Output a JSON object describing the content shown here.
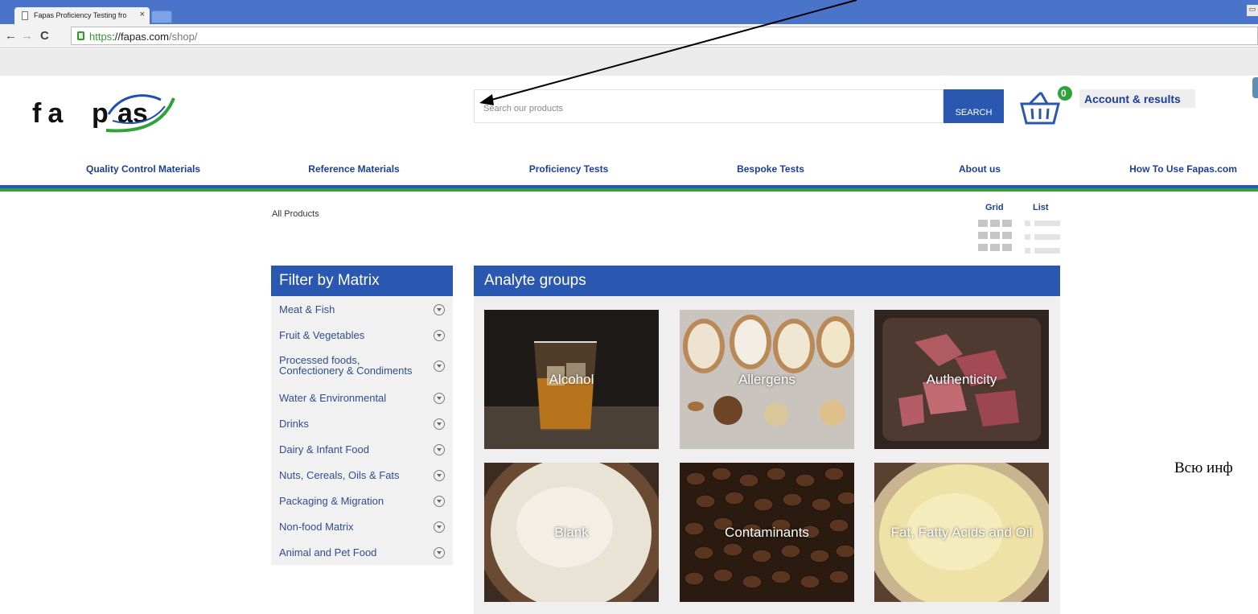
{
  "browser": {
    "tab_title": "Fapas Proficiency Testing fro",
    "tab_close": "×",
    "url_scheme": "https",
    "url_host": "://fapas.com",
    "url_path": "/shop/",
    "back_label": "←",
    "forward_label": "→",
    "reload_label": "C"
  },
  "header": {
    "logo_text": "fapas",
    "search_placeholder": "Search our products",
    "search_button": "SEARCH",
    "cart_count": "0",
    "account_label": "Account & results"
  },
  "nav": {
    "items": [
      {
        "label": "Quality Control Materials"
      },
      {
        "label": "Reference Materials"
      },
      {
        "label": "Proficiency Tests"
      },
      {
        "label": "Bespoke Tests"
      },
      {
        "label": "About us"
      },
      {
        "label": "How To Use Fapas.com"
      }
    ]
  },
  "breadcrumb": "All Products",
  "view": {
    "grid_label": "Grid",
    "list_label": "List"
  },
  "filter": {
    "title": "Filter by Matrix",
    "items": [
      {
        "label": "Meat & Fish"
      },
      {
        "label": "Fruit & Vegetables"
      },
      {
        "label": "Processed foods,\nConfectionery & Condiments"
      },
      {
        "label": "Water & Environmental"
      },
      {
        "label": "Drinks"
      },
      {
        "label": "Dairy & Infant Food"
      },
      {
        "label": "Nuts, Cereals, Oils & Fats"
      },
      {
        "label": "Packaging & Migration"
      },
      {
        "label": "Non-food Matrix"
      },
      {
        "label": "Animal and Pet Food"
      }
    ]
  },
  "analyte": {
    "title": "Analyte groups",
    "tiles": [
      {
        "label": "Alcohol"
      },
      {
        "label": "Allergens"
      },
      {
        "label": "Authenticity"
      },
      {
        "label": "Blank"
      },
      {
        "label": "Contaminants"
      },
      {
        "label": "Fat, Fatty Acids and Oil"
      }
    ]
  },
  "side_text": "Всю инф"
}
